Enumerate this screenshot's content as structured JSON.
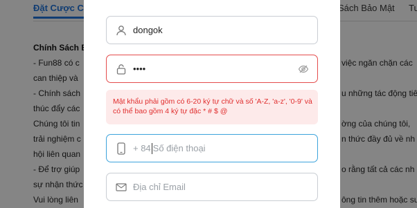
{
  "background": {
    "tab_active": "Đặt Cược C",
    "tab_2": "Sách Bảo Mật",
    "tab_3": "Tu",
    "heading": "Chính Sách B",
    "left_lines": [
      "- Fun88 có c",
      "can thiệp và",
      "- Chính sách",
      "thúc đẩy các",
      "Chúng tôi tin",
      "trải nghiệm c",
      "hội liên quan",
      "- Để trợ giúp",
      "sự nhận thức",
      "Vui lòng liên"
    ],
    "right_lines": [
      "việc ngăn chặn các",
      "u những tác động tiê",
      "ờng của chúng tôi,",
      "n thức đầy đủ về nh",
      "o rằng tất cả các nh",
      "ông tin thêm hoặc sư"
    ]
  },
  "form": {
    "username": {
      "value": "dongok",
      "icon": "user-icon"
    },
    "password": {
      "value": "••••",
      "icon": "lock-icon",
      "toggle_icon": "eye-off-icon"
    },
    "password_error": "Mật khẩu phải gồm có 6-20 ký tự chữ và số 'A-Z, 'a-z', '0-9' và có thể bao gồm 4 ký tự đặc * # $ @",
    "phone": {
      "prefix": "+ 84",
      "placeholder": "Số điện thoại",
      "icon": "phone-icon"
    },
    "email": {
      "placeholder": "Địa chỉ Email",
      "icon": "mail-icon"
    }
  },
  "colors": {
    "error": "#e44b4b",
    "error_text": "#e02d2d",
    "error_bg": "#fdeaea",
    "focus": "#3ba3dc",
    "link": "#1f6fd1"
  }
}
